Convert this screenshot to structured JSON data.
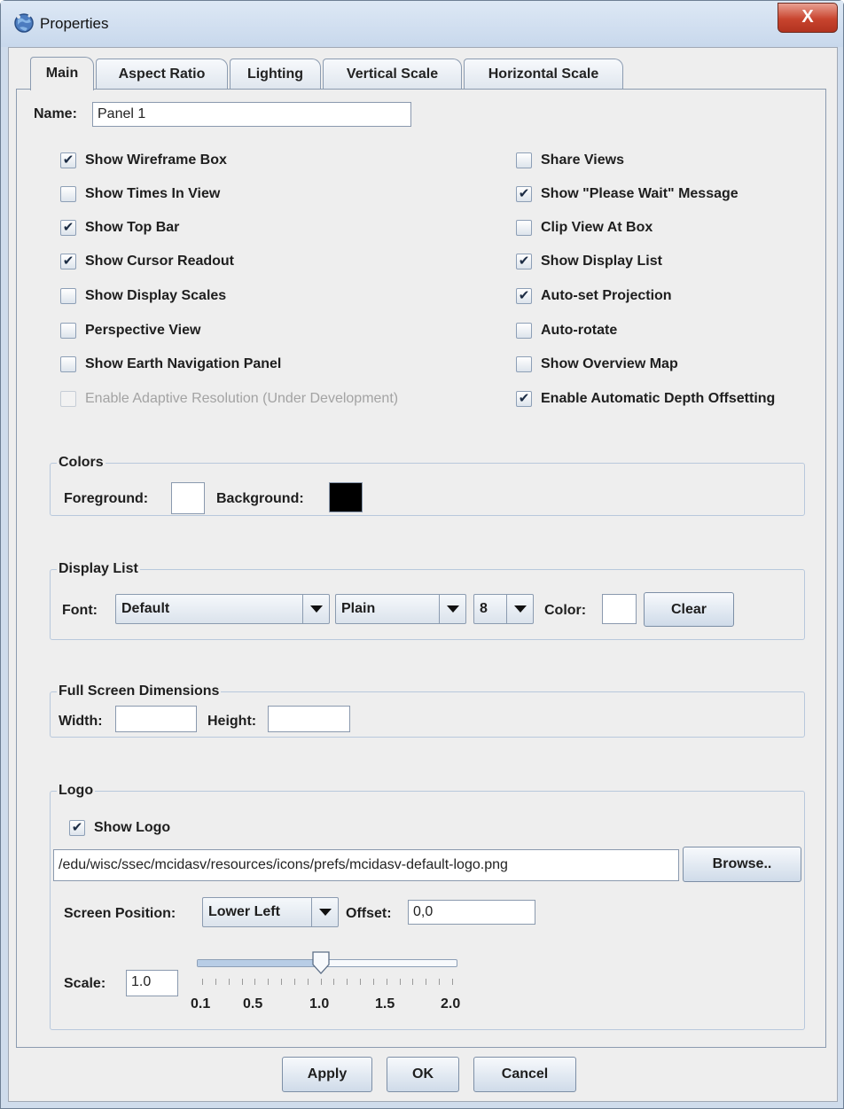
{
  "window": {
    "title": "Properties",
    "close_glyph": "X"
  },
  "tabs": [
    {
      "label": "Main",
      "active": true
    },
    {
      "label": "Aspect Ratio"
    },
    {
      "label": "Lighting"
    },
    {
      "label": "Vertical Scale"
    },
    {
      "label": "Horizontal Scale"
    }
  ],
  "name": {
    "label": "Name:",
    "value": "Panel 1"
  },
  "checkboxes_left": [
    {
      "label": "Show Wireframe Box",
      "checked": true
    },
    {
      "label": "Show Times In View",
      "checked": false
    },
    {
      "label": "Show Top Bar",
      "checked": true
    },
    {
      "label": "Show Cursor Readout",
      "checked": true
    },
    {
      "label": "Show Display Scales",
      "checked": false
    },
    {
      "label": "Perspective View",
      "checked": false
    },
    {
      "label": "Show Earth Navigation Panel",
      "checked": false
    },
    {
      "label": "Enable Adaptive Resolution (Under Development)",
      "checked": false,
      "disabled": true
    }
  ],
  "checkboxes_right": [
    {
      "label": "Share Views",
      "checked": false
    },
    {
      "label": "Show \"Please Wait\" Message",
      "checked": true
    },
    {
      "label": "Clip View At Box",
      "checked": false
    },
    {
      "label": "Show Display List",
      "checked": true
    },
    {
      "label": "Auto-set Projection",
      "checked": true
    },
    {
      "label": "Auto-rotate",
      "checked": false
    },
    {
      "label": "Show Overview Map",
      "checked": false
    },
    {
      "label": "Enable Automatic Depth Offsetting",
      "checked": true
    }
  ],
  "colors": {
    "title": "Colors",
    "foreground_label": "Foreground:",
    "foreground_color": "#ffffff",
    "background_label": "Background:",
    "background_color": "#000000"
  },
  "display_list": {
    "title": "Display List",
    "font_label": "Font:",
    "font_value": "Default",
    "style_value": "Plain",
    "size_value": "8",
    "color_label": "Color:",
    "color_value": "#ffffff",
    "clear_label": "Clear"
  },
  "full_screen": {
    "title": "Full Screen Dimensions",
    "width_label": "Width:",
    "width_value": "",
    "height_label": "Height:",
    "height_value": ""
  },
  "logo": {
    "title": "Logo",
    "show_logo_label": "Show Logo",
    "show_logo_checked": true,
    "path_value": "/edu/wisc/ssec/mcidasv/resources/icons/prefs/mcidasv-default-logo.png",
    "browse_label": "Browse..",
    "screen_position_label": "Screen Position:",
    "screen_position_value": "Lower Left",
    "offset_label": "Offset:",
    "offset_value": "0,0",
    "scale_label": "Scale:",
    "scale_value": "1.0",
    "slider": {
      "min": 0.1,
      "max": 2.0,
      "value": 1.0,
      "tick_labels": [
        "0.1",
        "0.5",
        "1.0",
        "1.5",
        "2.0"
      ]
    }
  },
  "buttons": {
    "apply": "Apply",
    "ok": "OK",
    "cancel": "Cancel"
  }
}
